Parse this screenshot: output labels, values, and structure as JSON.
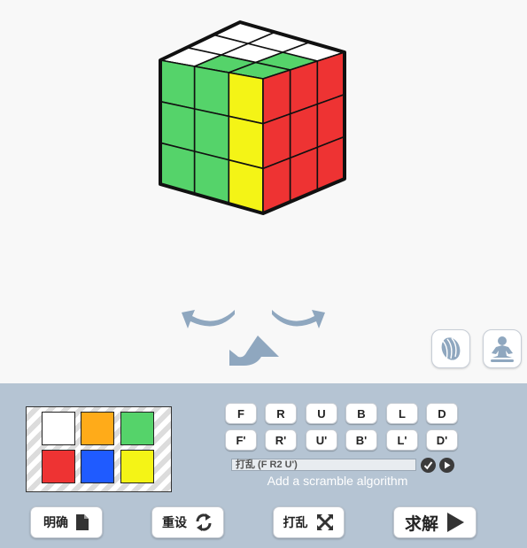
{
  "colors": {
    "white": "#ffffff",
    "orange": "#ffab19",
    "green": "#55d36a",
    "red": "#ee3333",
    "blue": "#1f5bff",
    "yellow": "#f4f416",
    "panel_bg": "#b5c4d3",
    "arrow": "#8fa7bf"
  },
  "cube": {
    "up": [
      [
        "white",
        "white",
        "white"
      ],
      [
        "white",
        "white",
        "green"
      ],
      [
        "white",
        "green",
        "green"
      ]
    ],
    "front": [
      [
        "green",
        "green",
        "yellow"
      ],
      [
        "green",
        "green",
        "yellow"
      ],
      [
        "green",
        "green",
        "yellow"
      ]
    ],
    "right": [
      [
        "red",
        "red",
        "red"
      ],
      [
        "red",
        "red",
        "red"
      ],
      [
        "red",
        "red",
        "red"
      ]
    ]
  },
  "view_controls": {
    "rotate_left_icon": "rotate-left-arrow",
    "rotate_right_icon": "rotate-right-arrow",
    "rotate_up_icon": "rotate-up-arrow",
    "hand_icon": "hand-icon",
    "meditate_icon": "meditating-person-icon"
  },
  "palette": [
    "white",
    "orange",
    "green",
    "red",
    "blue",
    "yellow"
  ],
  "moves": {
    "row1": [
      "F",
      "R",
      "U",
      "B",
      "L",
      "D"
    ],
    "row2": [
      "F'",
      "R'",
      "U'",
      "B'",
      "L'",
      "D'"
    ]
  },
  "scramble": {
    "value": "打乱 (F R2 U')",
    "hint": "Add a scramble algorithm"
  },
  "actions": {
    "clear_label": "明确",
    "reset_label": "重设",
    "scramble_label": "打乱",
    "solve_label": "求解"
  }
}
